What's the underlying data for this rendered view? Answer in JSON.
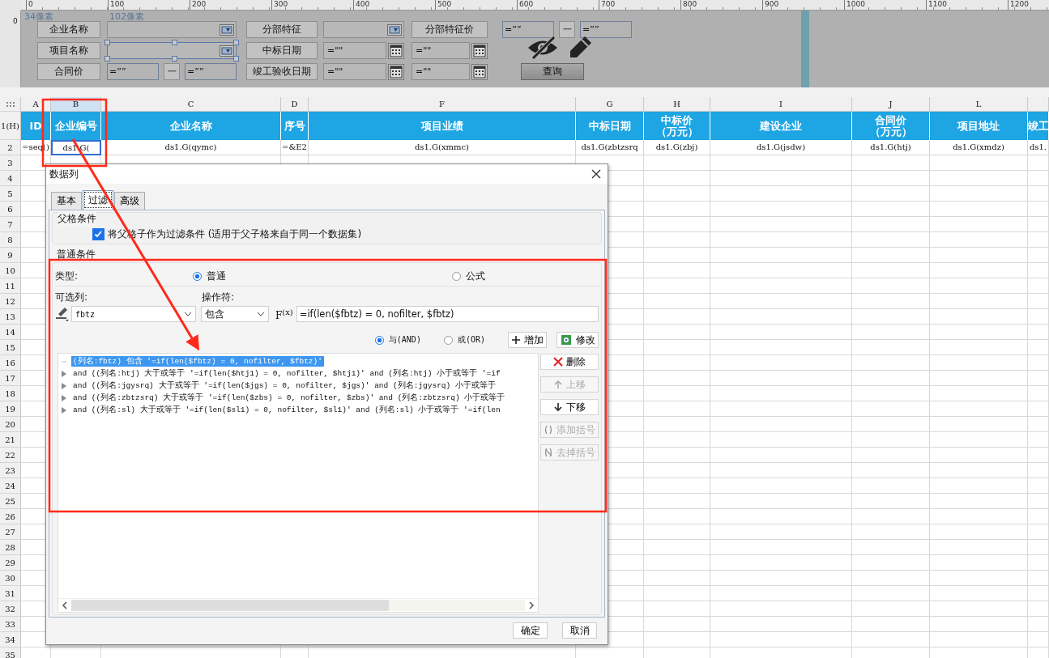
{
  "ruler": {
    "labels": [
      "0",
      "100",
      "200",
      "300",
      "400",
      "500",
      "600",
      "700",
      "800",
      "900",
      "1000",
      "1100",
      "1200"
    ],
    "vertical_label": "0"
  },
  "parameter_pane": {
    "annotations": [
      "34像素",
      "102像素"
    ],
    "rows": [
      {
        "cells": [
          [
            {
              "kind": "label",
              "text": "企业名称"
            }
          ],
          [
            {
              "kind": "combo",
              "selected": false
            }
          ],
          [
            {
              "kind": "label",
              "text": "分部特征"
            }
          ],
          [
            {
              "kind": "combo",
              "selected": false
            }
          ],
          [
            {
              "kind": "label",
              "text": "分部特征价"
            }
          ],
          [
            {
              "kind": "text",
              "value": "=””"
            },
            {
              "kind": "dash",
              "text": "一"
            },
            {
              "kind": "text",
              "value": "=””"
            }
          ]
        ]
      },
      {
        "cells": [
          [
            {
              "kind": "label",
              "text": "项目名称"
            }
          ],
          [
            {
              "kind": "combo",
              "selected": true
            }
          ],
          [
            {
              "kind": "label",
              "text": "中标日期"
            }
          ],
          [
            {
              "kind": "date",
              "value": "=\"\""
            }
          ],
          [
            {
              "kind": "date",
              "value": "=\"\""
            }
          ],
          []
        ]
      },
      {
        "cells": [
          [
            {
              "kind": "label",
              "text": "合同价"
            }
          ],
          [
            {
              "kind": "text",
              "value": "=””"
            },
            {
              "kind": "dash",
              "text": "一"
            },
            {
              "kind": "text",
              "value": "=””"
            }
          ],
          [
            {
              "kind": "label",
              "text": "竣工验收日期"
            }
          ],
          [
            {
              "kind": "date",
              "value": "=\"\""
            }
          ],
          [
            {
              "kind": "date",
              "value": "=\"\""
            }
          ],
          [
            {
              "kind": "button",
              "text": "查询"
            }
          ]
        ]
      }
    ]
  },
  "sheet": {
    "columns": [
      {
        "label": "A",
        "selected": false
      },
      {
        "label": "B",
        "selected": true
      },
      {
        "label": "C",
        "selected": false
      },
      {
        "label": "D",
        "selected": false
      },
      {
        "label": "F",
        "selected": false
      },
      {
        "label": "G",
        "selected": false
      },
      {
        "label": "H",
        "selected": false
      },
      {
        "label": "I",
        "selected": false
      },
      {
        "label": "J",
        "selected": false
      },
      {
        "label": "L",
        "selected": false
      }
    ],
    "row_numbers": [
      "1(H)",
      "2",
      "3",
      "4",
      "5",
      "6",
      "7",
      "8",
      "9",
      "10",
      "11",
      "12",
      "13",
      "14",
      "15",
      "16",
      "17",
      "18",
      "19",
      "20",
      "21",
      "22",
      "23",
      "24",
      "25",
      "26",
      "27",
      "28",
      "29",
      "30",
      "31",
      "32",
      "33",
      "34",
      "35"
    ],
    "header_row": [
      "ID",
      "企业编号",
      "企业名称",
      "序号",
      "项目业绩",
      "中标日期",
      "中标价（万元）",
      "建设企业",
      "合同价（万元）",
      "项目地址",
      "竣工"
    ],
    "data_row": [
      {
        "text": "=seq()",
        "selected": false
      },
      {
        "text": "ds1.G(",
        "selected": true
      },
      {
        "text": "ds1.G(qymc)",
        "selected": false
      },
      {
        "text": "=&E2",
        "selected": false
      },
      {
        "text": "ds1.G(xmmc)",
        "selected": false
      },
      {
        "text": "ds1.G(zbtzsrq",
        "selected": false
      },
      {
        "text": "ds1.G(zbj)",
        "selected": false
      },
      {
        "text": "ds1.G(jsdw)",
        "selected": false
      },
      {
        "text": "ds1.G(htj)",
        "selected": false
      },
      {
        "text": "ds1.G(xmdz)",
        "selected": false
      },
      {
        "text": "ds1.",
        "selected": false
      }
    ]
  },
  "dialog": {
    "title": "数据列",
    "tabs": [
      {
        "label": "基本",
        "selected": false
      },
      {
        "label": "过滤",
        "selected": true
      },
      {
        "label": "高级",
        "selected": false
      }
    ],
    "parent_group": {
      "title": "父格条件",
      "checkbox": {
        "label": "将父格子作为过滤条件 (适用于父子格来自于同一个数据集)",
        "checked": true
      }
    },
    "normal_group": {
      "title": "普通条件",
      "type_label": "类型:",
      "type_options": [
        {
          "label": "普通",
          "selected": true
        },
        {
          "label": "公式",
          "selected": false
        }
      ],
      "column_label": "可选列:",
      "operator_label": "操作符:",
      "column_value": "fbtz",
      "operator_value": "包含",
      "formula_button": "F$^{(x)}$",
      "formula": "=if(len($fbtz) = 0, nofilter, $fbtz)",
      "logic_options": [
        {
          "label": "与(AND)",
          "selected": true
        },
        {
          "label": "或(OR)",
          "selected": false
        }
      ],
      "add_button": "增加",
      "modify_button": "修改",
      "conditions": [
        {
          "text": "(列名:fbtz) 包含 '=if(len($fbtz) = 0, nofilter, $fbtz)'",
          "selected": true,
          "expandable": false
        },
        {
          "text": "and ((列名:htj) 大于或等于 '=if(len($htj1) = 0, nofilter, $htj1)' and (列名:htj) 小于或等于 '=if",
          "selected": false,
          "expandable": true
        },
        {
          "text": "and ((列名:jgysrq) 大于或等于 '=if(len($jgs) = 0, nofilter, $jgs)' and (列名:jgysrq) 小于或等于",
          "selected": false,
          "expandable": true
        },
        {
          "text": "and ((列名:zbtzsrq) 大于或等于 '=if(len($zbs) = 0, nofilter, $zbs)' and (列名:zbtzsrq) 小于或等于",
          "selected": false,
          "expandable": true
        },
        {
          "text": "and ((列名:sl) 大于或等于 '=if(len($sl1) = 0, nofilter, $sl1)' and (列名:sl) 小于或等于 '=if(len",
          "selected": false,
          "expandable": true
        }
      ],
      "side_buttons": [
        {
          "label": "删除",
          "disabled": false
        },
        {
          "label": "上移",
          "disabled": true
        },
        {
          "label": "下移",
          "disabled": false
        },
        {
          "label": "添加括号",
          "disabled": true
        },
        {
          "label": "去掉括号",
          "disabled": true
        }
      ]
    },
    "buttons": [
      "确定",
      "取消"
    ]
  }
}
